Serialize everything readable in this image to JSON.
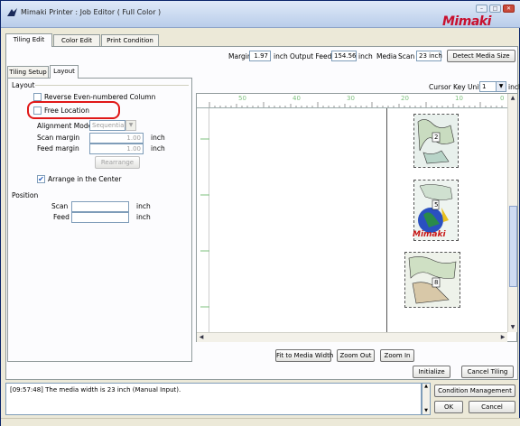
{
  "window": {
    "title": "Mimaki Printer : Job Editor ( Full Color )",
    "logo": "Mimaki",
    "minimize_label": "–",
    "maximize_label": "□",
    "close_label": "✕"
  },
  "main_tabs": [
    {
      "label": "Tiling Edit",
      "active": true
    },
    {
      "label": "Color Edit",
      "active": false
    },
    {
      "label": "Print Condition",
      "active": false
    }
  ],
  "info_bar": {
    "margin_label": "Margin",
    "margin_value": "1.97",
    "margin_unit": "inch",
    "output_feed_label": "Output Feed",
    "output_feed_value": "154.56",
    "output_feed_unit": "inch",
    "media_label": "Media",
    "scan_label": "Scan",
    "scan_value": "23 inch",
    "detect_button": "Detect Media Size"
  },
  "sub_tabs": [
    {
      "label": "Tiling Setup",
      "active": false
    },
    {
      "label": "Layout",
      "active": true
    }
  ],
  "layout_panel": {
    "section_title": "Layout",
    "reverse_label": "Reverse Even-numbered Column",
    "free_location_label": "Free Location",
    "alignment_label": "Alignment Mode",
    "alignment_value": "Sequential",
    "scan_margin_label": "Scan margin",
    "scan_margin_value": "1.00",
    "feed_margin_label": "Feed margin",
    "feed_margin_value": "1.00",
    "unit": "inch",
    "rearrange_button": "Rearrange",
    "arrange_center_label": "Arrange in the Center",
    "arrange_center_checked": true,
    "position_title": "Position",
    "pos_scan_label": "Scan",
    "pos_feed_label": "Feed",
    "pos_unit": "inch"
  },
  "canvas": {
    "cursor_key_label": "Cursor Key Unit",
    "cursor_key_value": "1",
    "cursor_key_unit": "inch",
    "ruler_labels": [
      "50",
      "40",
      "30",
      "20",
      "10",
      "0"
    ],
    "tiles": [
      {
        "label": "2"
      },
      {
        "label": "5"
      },
      {
        "label": "8"
      }
    ],
    "overlay_text": "Mimaki"
  },
  "canvas_buttons": {
    "fit": "Fit to Media Width",
    "zoom_out": "Zoom Out",
    "zoom_in": "Zoom In"
  },
  "action_buttons": {
    "initialize": "Initialize",
    "cancel_tiling": "Cancel Tiling"
  },
  "log": {
    "message": "[09:57:48] The media width is 23 inch (Manual Input)."
  },
  "bottom_buttons": {
    "condition": "Condition Management",
    "ok": "OK",
    "cancel": "Cancel"
  }
}
